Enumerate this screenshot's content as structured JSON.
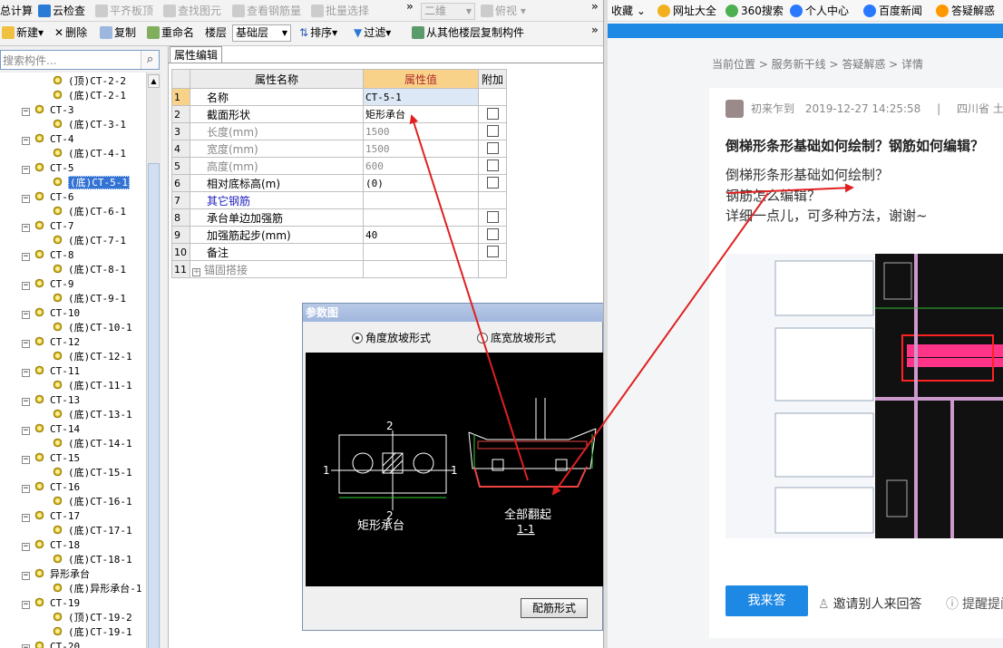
{
  "toolbar1": {
    "items": [
      "总计算",
      "云检查",
      "平齐板顶",
      "查找图元",
      "查看钢筋量",
      "批量选择"
    ],
    "view_combo": "二维",
    "view_mode": "俯视"
  },
  "toolbar2": {
    "new": "新建",
    "delete": "删除",
    "copy": "复制",
    "rename": "重命名",
    "floor_label": "楼层",
    "floor_value": "基础层",
    "sort": "排序",
    "filter": "过滤",
    "copy_from": "从其他楼层复制构件"
  },
  "search": {
    "placeholder": "搜索构件..."
  },
  "tree": [
    {
      "level": 2,
      "label": "(顶)CT-2-2"
    },
    {
      "level": 2,
      "label": "(底)CT-2-1"
    },
    {
      "level": 1,
      "label": "CT-3"
    },
    {
      "level": 2,
      "label": "(底)CT-3-1"
    },
    {
      "level": 1,
      "label": "CT-4"
    },
    {
      "level": 2,
      "label": "(底)CT-4-1"
    },
    {
      "level": 1,
      "label": "CT-5"
    },
    {
      "level": 2,
      "label": "(底)CT-5-1",
      "selected": true
    },
    {
      "level": 1,
      "label": "CT-6"
    },
    {
      "level": 2,
      "label": "(底)CT-6-1"
    },
    {
      "level": 1,
      "label": "CT-7"
    },
    {
      "level": 2,
      "label": "(底)CT-7-1"
    },
    {
      "level": 1,
      "label": "CT-8"
    },
    {
      "level": 2,
      "label": "(底)CT-8-1"
    },
    {
      "level": 1,
      "label": "CT-9"
    },
    {
      "level": 2,
      "label": "(底)CT-9-1"
    },
    {
      "level": 1,
      "label": "CT-10"
    },
    {
      "level": 2,
      "label": "(底)CT-10-1"
    },
    {
      "level": 1,
      "label": "CT-12"
    },
    {
      "level": 2,
      "label": "(底)CT-12-1"
    },
    {
      "level": 1,
      "label": "CT-11"
    },
    {
      "level": 2,
      "label": "(底)CT-11-1"
    },
    {
      "level": 1,
      "label": "CT-13"
    },
    {
      "level": 2,
      "label": "(底)CT-13-1"
    },
    {
      "level": 1,
      "label": "CT-14"
    },
    {
      "level": 2,
      "label": "(底)CT-14-1"
    },
    {
      "level": 1,
      "label": "CT-15"
    },
    {
      "level": 2,
      "label": "(底)CT-15-1"
    },
    {
      "level": 1,
      "label": "CT-16"
    },
    {
      "level": 2,
      "label": "(底)CT-16-1"
    },
    {
      "level": 1,
      "label": "CT-17"
    },
    {
      "level": 2,
      "label": "(底)CT-17-1"
    },
    {
      "level": 1,
      "label": "CT-18"
    },
    {
      "level": 2,
      "label": "(底)CT-18-1"
    },
    {
      "level": 1,
      "label": "异形承台"
    },
    {
      "level": 2,
      "label": "(底)异形承台-1"
    },
    {
      "level": 1,
      "label": "CT-19"
    },
    {
      "level": 2,
      "label": "(顶)CT-19-2"
    },
    {
      "level": 2,
      "label": "(底)CT-19-1"
    },
    {
      "level": 1,
      "label": "CT-20"
    }
  ],
  "props": {
    "tab": "属性编辑",
    "headers": [
      "属性名称",
      "属性值",
      "附加"
    ],
    "rows": [
      {
        "n": "1",
        "name": "名称",
        "value": "CT-5-1",
        "style": "normal",
        "check": false
      },
      {
        "n": "2",
        "name": "截面形状",
        "value": "矩形承台",
        "style": "normal",
        "check": true
      },
      {
        "n": "3",
        "name": "长度(mm)",
        "value": "1500",
        "style": "gray",
        "check": true
      },
      {
        "n": "4",
        "name": "宽度(mm)",
        "value": "1500",
        "style": "gray",
        "check": true
      },
      {
        "n": "5",
        "name": "高度(mm)",
        "value": "600",
        "style": "gray",
        "check": true
      },
      {
        "n": "6",
        "name": "相对底标高(m)",
        "value": "(0)",
        "style": "normal",
        "check": true
      },
      {
        "n": "7",
        "name": "其它钢筋",
        "value": "",
        "style": "blue",
        "check": false
      },
      {
        "n": "8",
        "name": "承台单边加强筋",
        "value": "",
        "style": "normal",
        "check": true
      },
      {
        "n": "9",
        "name": "加强筋起步(mm)",
        "value": "40",
        "style": "normal",
        "check": true
      },
      {
        "n": "10",
        "name": "备注",
        "value": "",
        "style": "normal",
        "check": true
      },
      {
        "n": "11",
        "name": "锚固搭接",
        "value": "",
        "style": "gray",
        "check": false
      }
    ]
  },
  "dialog": {
    "title": "参数图",
    "radio1": "角度放坡形式",
    "radio2": "底宽放坡形式",
    "plan_label": "矩形承台",
    "section_label": "全部翻起",
    "section_mark": "1-1",
    "dim_2": "2",
    "dim_1": "1",
    "button": "配筋形式"
  },
  "browser": {
    "bookmarks": [
      "收藏",
      "网址大全",
      "360搜索",
      "个人中心",
      "百度新闻",
      "答疑解惑"
    ],
    "breadcrumb": "当前位置 > 服务新干线 > 答疑解惑 > 详情",
    "author": "初来乍到",
    "date": "2019-12-27 14:25:58",
    "sep": "|",
    "region": "四川省 土建",
    "title": "倒梯形条形基础如何绘制？钢筋如何编辑？",
    "lines": [
      "倒梯形条形基础如何绘制？",
      "钢筋怎么编辑？",
      "详细一点儿，可多种方法，谢谢~"
    ],
    "answer_button": "我来答",
    "invite": "邀请别人来回答",
    "remind": "提醒提问者"
  },
  "colors": {
    "accent": "#1e88e5",
    "arrow": "#e02020",
    "header_value": "#f9d28a"
  }
}
